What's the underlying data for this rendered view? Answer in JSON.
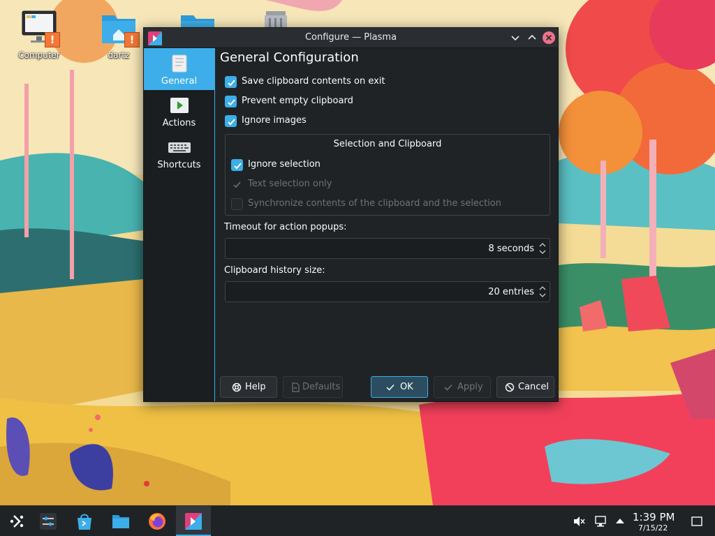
{
  "desktop": {
    "icons": [
      {
        "label": "Computer",
        "icon": "computer-icon",
        "badge": "!"
      },
      {
        "label": "dartz",
        "icon": "home-folder-icon",
        "badge": "!"
      },
      {
        "label": "",
        "icon": "folder-icon"
      },
      {
        "label": "",
        "icon": "trash-icon"
      }
    ]
  },
  "window": {
    "title": "Configure — Plasma",
    "sidebar": {
      "items": [
        {
          "label": "General",
          "icon": "general-page-icon",
          "active": true
        },
        {
          "label": "Actions",
          "icon": "actions-play-icon",
          "active": false
        },
        {
          "label": "Shortcuts",
          "icon": "keyboard-icon",
          "active": false
        }
      ]
    },
    "page": {
      "heading": "General Configuration",
      "options": [
        {
          "label": "Save clipboard contents on exit",
          "checked": true
        },
        {
          "label": "Prevent empty clipboard",
          "checked": true
        },
        {
          "label": "Ignore images",
          "checked": true
        }
      ],
      "selection_group": {
        "title": "Selection and Clipboard",
        "options": [
          {
            "label": "Ignore selection",
            "checked": true,
            "enabled": true
          },
          {
            "label": "Text selection only",
            "checked": true,
            "enabled": false
          },
          {
            "label": "Synchronize contents of the clipboard and the selection",
            "checked": false,
            "enabled": false
          }
        ]
      },
      "timeout": {
        "label": "Timeout for action popups:",
        "value": "8 seconds"
      },
      "history": {
        "label": "Clipboard history size:",
        "value": "20 entries"
      }
    },
    "buttons": {
      "help": "Help",
      "defaults": "Defaults",
      "ok": "OK",
      "apply": "Apply",
      "cancel": "Cancel"
    }
  },
  "taskbar": {
    "items": [
      {
        "icon": "application-launcher-icon"
      },
      {
        "icon": "system-settings-icon"
      },
      {
        "icon": "discover-store-icon"
      },
      {
        "icon": "dolphin-file-manager-icon"
      },
      {
        "icon": "firefox-icon"
      },
      {
        "icon": "klipper-clipboard-icon",
        "active": true
      }
    ],
    "tray": [
      "volume-muted-icon",
      "network-icon",
      "expand-tray-icon"
    ],
    "clock": {
      "time": "1:39 PM",
      "date": "7/15/22"
    }
  },
  "colors": {
    "accent": "#3daee9",
    "window_bg": "#202326",
    "sidebar_bg": "#1b1e20",
    "close_button": "#f0718a",
    "warning_badge": "#f47735"
  }
}
